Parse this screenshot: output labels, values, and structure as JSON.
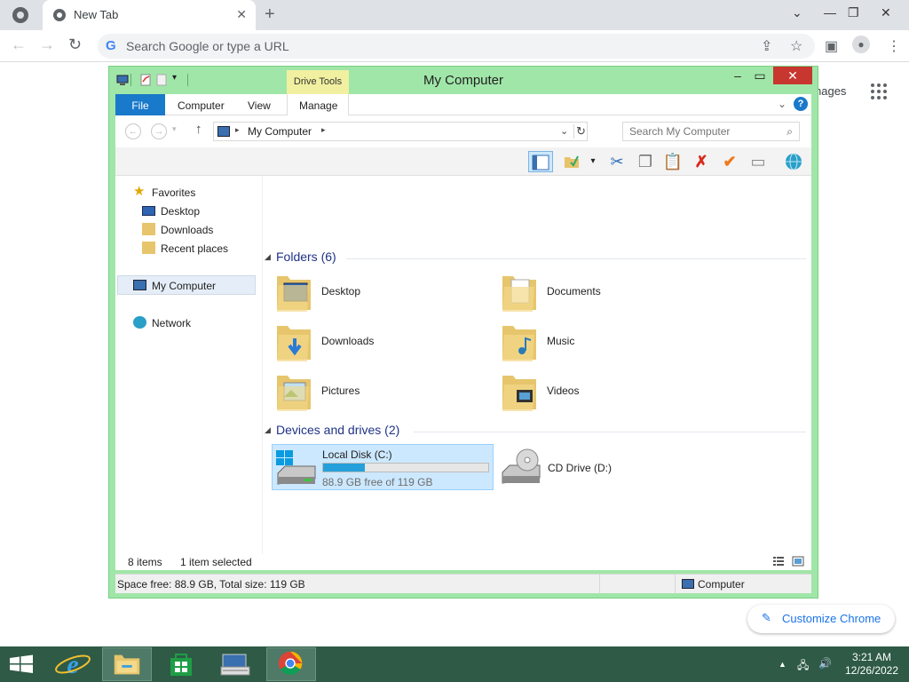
{
  "browser": {
    "tab_title": "New Tab",
    "tab_close": "✕",
    "new_tab": "+",
    "omnibox_placeholder": "Search Google or type a URL",
    "images_link": "nages",
    "customize_label": "Customize Chrome",
    "win_min": "⌄",
    "win_restore": "—",
    "win_max": "❐",
    "win_close": "✕"
  },
  "explorer": {
    "title": "My Computer",
    "drive_tools": "Drive Tools",
    "ribbon_tabs": [
      "File",
      "Computer",
      "View",
      "Manage"
    ],
    "address_crumb": "My Computer",
    "search_placeholder": "Search My Computer",
    "nav": {
      "favorites": "Favorites",
      "desktop": "Desktop",
      "downloads": "Downloads",
      "recent": "Recent places",
      "my_computer": "My Computer",
      "network": "Network"
    },
    "folders_header": "Folders (6)",
    "folders": [
      {
        "name": "Desktop"
      },
      {
        "name": "Documents"
      },
      {
        "name": "Downloads"
      },
      {
        "name": "Music"
      },
      {
        "name": "Pictures"
      },
      {
        "name": "Videos"
      }
    ],
    "devices_header": "Devices and drives (2)",
    "drives": {
      "c_name": "Local Disk (C:)",
      "c_free": "88.9 GB free of 119 GB",
      "c_used_fraction": 0.253,
      "d_name": "CD Drive (D:)"
    },
    "items_count": "8 items",
    "items_selected": "1 item selected",
    "status_left": "Space free: 88.9 GB, Total size: 119 GB",
    "status_right": "Computer"
  },
  "taskbar": {
    "time": "3:21 AM",
    "date": "12/26/2022"
  },
  "colors": {
    "explorer_frame": "#a0e6a8",
    "file_tab": "#1979ca",
    "drive_bar": "#26a0da",
    "taskbar": "#2e5a46"
  }
}
